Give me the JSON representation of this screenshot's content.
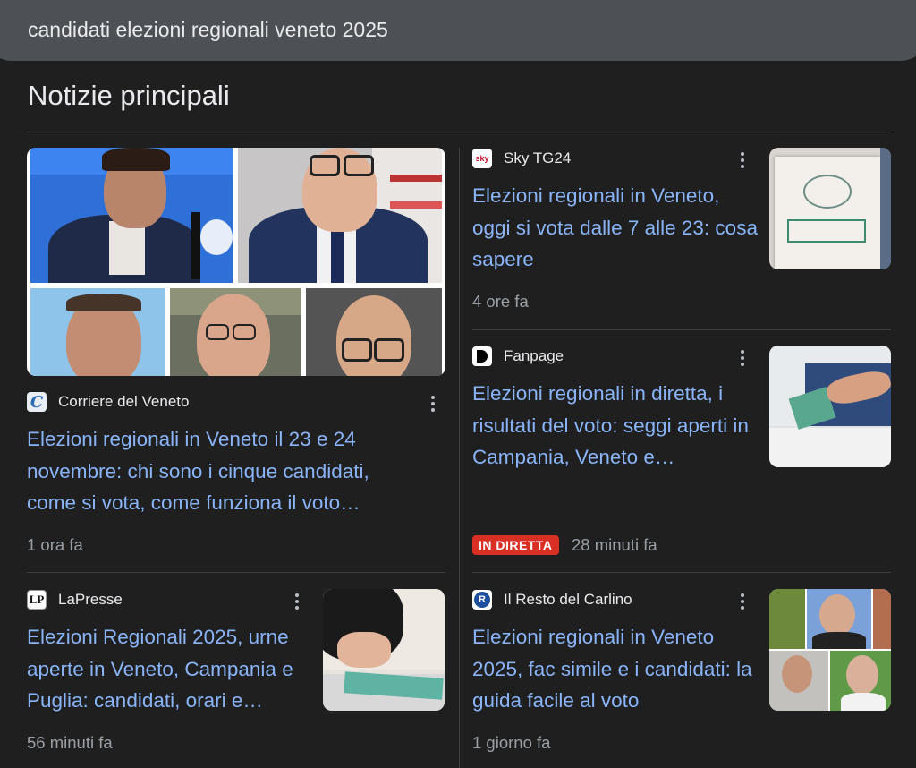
{
  "search": {
    "query": "candidati elezioni regionali veneto 2025"
  },
  "section": {
    "title": "Notizie principali"
  },
  "articles": [
    {
      "source": "Corriere del Veneto",
      "logo": "corriere-logo-icon",
      "headline": "Elezioni regionali in Veneto il 23 e 24 novembre: chi sono i cinque candidati, come si vota, come funziona il voto…",
      "time": "1 ora fa"
    },
    {
      "source": "Sky TG24",
      "logo": "skytg24-logo-icon",
      "headline": "Elezioni regionali in Veneto, oggi si vota dalle 7 alle 23: cosa sapere",
      "time": "4 ore fa"
    },
    {
      "source": "Fanpage",
      "logo": "fanpage-logo-icon",
      "headline": "Elezioni regionali in diretta, i risultati del voto: seggi aperti in Campania, Veneto e…",
      "badge": "IN DIRETTA",
      "time": "28 minuti fa"
    },
    {
      "source": "LaPresse",
      "logo": "lapresse-logo-icon",
      "headline": "Elezioni Regionali 2025, urne aperte in Veneto, Campania e Puglia: candidati, orari e…",
      "time": "56 minuti fa"
    },
    {
      "source": "Il Resto del Carlino",
      "logo": "resto-del-carlino-logo-icon",
      "headline": "Elezioni regionali in Veneto 2025, fac simile e i candidati: la guida facile al voto",
      "time": "1 giorno fa"
    }
  ],
  "logo_text": {
    "sky": "sky",
    "lapresse": "LP",
    "carlino": "R"
  },
  "colors": {
    "background": "#1f1f1f",
    "link": "#8ab4f8",
    "live_badge": "#d93025",
    "search_bar": "#4d5156"
  }
}
